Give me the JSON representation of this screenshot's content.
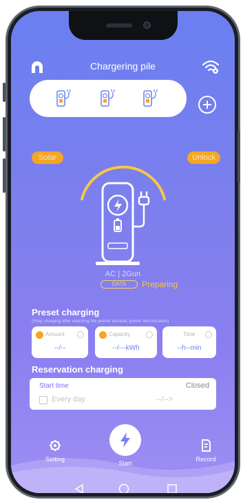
{
  "header": {
    "title": "Chargering pile"
  },
  "piles": [
    "pile-1",
    "pile-2",
    "pile-3"
  ],
  "tags": {
    "left": "Solar",
    "right": "Unlock"
  },
  "device": {
    "ac_label": "AC | 2Gun",
    "status_box": "DATA",
    "status": "Preparing"
  },
  "preset": {
    "title": "Preset charging",
    "note": "(Stop charging after reaching the preset amount, power and duration)",
    "cards": [
      {
        "name": "Amount",
        "value": "--/--"
      },
      {
        "name": "Capacity",
        "value": "--/---kWh"
      },
      {
        "name": "Time",
        "value": "--h--min"
      }
    ]
  },
  "reservation": {
    "title": "Reservation charging",
    "start_time_label": "Start time",
    "state": "Closed",
    "every_day": "Every day",
    "date_value": "--/-->"
  },
  "tabs": {
    "setting": "Setting",
    "start": "Start",
    "record": "Record"
  },
  "colors": {
    "accent": "#6a7ff0",
    "orange": "#f5a623",
    "yellow": "#f7c843"
  }
}
